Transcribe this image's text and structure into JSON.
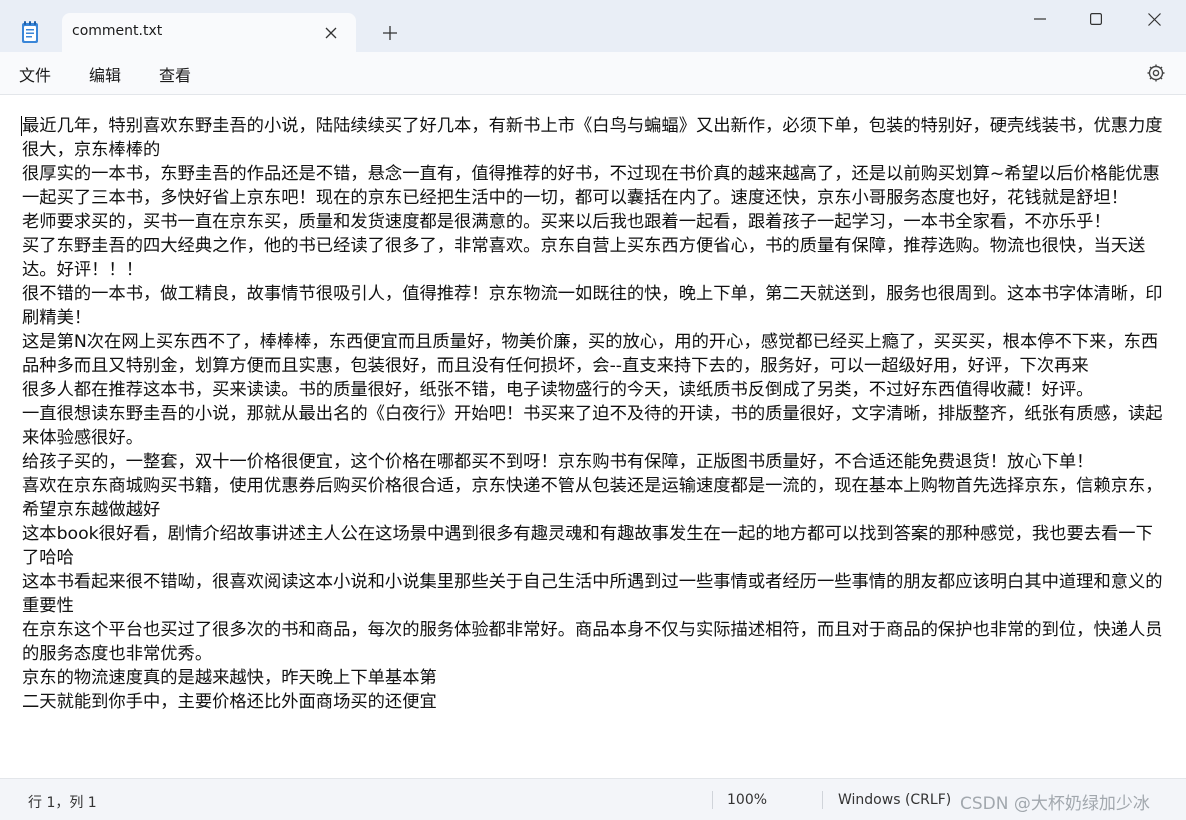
{
  "window": {
    "tab_title": "comment.txt",
    "icons": {
      "app": "notepad-icon",
      "close_tab": "close-icon",
      "new_tab": "plus-icon",
      "minimize": "minimize-icon",
      "maximize": "maximize-icon",
      "close_window": "close-icon"
    }
  },
  "menu": {
    "file": "文件",
    "edit": "编辑",
    "view": "查看",
    "settings_icon": "gear-icon"
  },
  "editor": {
    "content": "最近几年，特别喜欢东野圭吾的小说，陆陆续续买了好几本，有新书上市《白鸟与蝙蝠》又出新作，必须下单，包装的特别好，硬壳线装书，优惠力度很大，京东棒棒的\n很厚实的一本书，东野圭吾的作品还是不错，悬念一直有，值得推荐的好书，不过现在书价真的越来越高了，还是以前购买划算~希望以后价格能优惠\n一起买了三本书，多快好省上京东吧！现在的京东已经把生活中的一切，都可以囊括在内了。速度还快，京东小哥服务态度也好，花钱就是舒坦！\n老师要求买的，买书一直在京东买，质量和发货速度都是很满意的。买来以后我也跟着一起看，跟着孩子一起学习，一本书全家看，不亦乐乎！\n买了东野圭吾的四大经典之作，他的书已经读了很多了，非常喜欢。京东自营上买东西方便省心，书的质量有保障，推荐选购。物流也很快，当天送达。好评！！！\n很不错的一本书，做工精良，故事情节很吸引人，值得推荐！京东物流一如既往的快，晚上下单，第二天就送到，服务也很周到。这本书字体清晰，印刷精美！\n这是第N次在网上买东西不了，棒棒棒，东西便宜而且质量好，物美价廉，买的放心，用的开心，感觉都已经买上瘾了，买买买，根本停不下来，东西品种多而且又特别金，划算方便而且实惠，包装很好，而且没有任何损坏，会--直支来持下去的，服务好，可以一超级好用，好评，下次再来\n很多人都在推荐这本书，买来读读。书的质量很好，纸张不错，电子读物盛行的今天，读纸质书反倒成了另类，不过好东西值得收藏！好评。\n一直很想读东野圭吾的小说，那就从最出名的《白夜行》开始吧！书买来了迫不及待的开读，书的质量很好，文字清晰，排版整齐，纸张有质感，读起来体验感很好。\n给孩子买的，一整套，双十一价格很便宜，这个价格在哪都买不到呀！京东购书有保障，正版图书质量好，不合适还能免费退货！放心下单！\n喜欢在京东商城购买书籍，使用优惠券后购买价格很合适，京东快递不管从包装还是运输速度都是一流的，现在基本上购物首先选择京东，信赖京东，希望京东越做越好\n这本book很好看，剧情介绍故事讲述主人公在这场景中遇到很多有趣灵魂和有趣故事发生在一起的地方都可以找到答案的那种感觉，我也要去看一下了哈哈\n这本书看起来很不错呦，很喜欢阅读这本小说和小说集里那些关于自己生活中所遇到过一些事情或者经历一些事情的朋友都应该明白其中道理和意义的重要性\n在京东这个平台也买过了很多次的书和商品，每次的服务体验都非常好。商品本身不仅与实际描述相符，而且对于商品的保护也非常的到位，快递人员的服务态度也非常优秀。\n京东的物流速度真的是越来越快，昨天晚上下单基本第\n二天就能到你手中，主要价格还比外面商场买的还便宜"
  },
  "status": {
    "position": "行 1，列 1",
    "zoom": "100%",
    "line_ending": "Windows (CRLF)",
    "watermark": "CSDN @大杯奶绿加少冰"
  }
}
